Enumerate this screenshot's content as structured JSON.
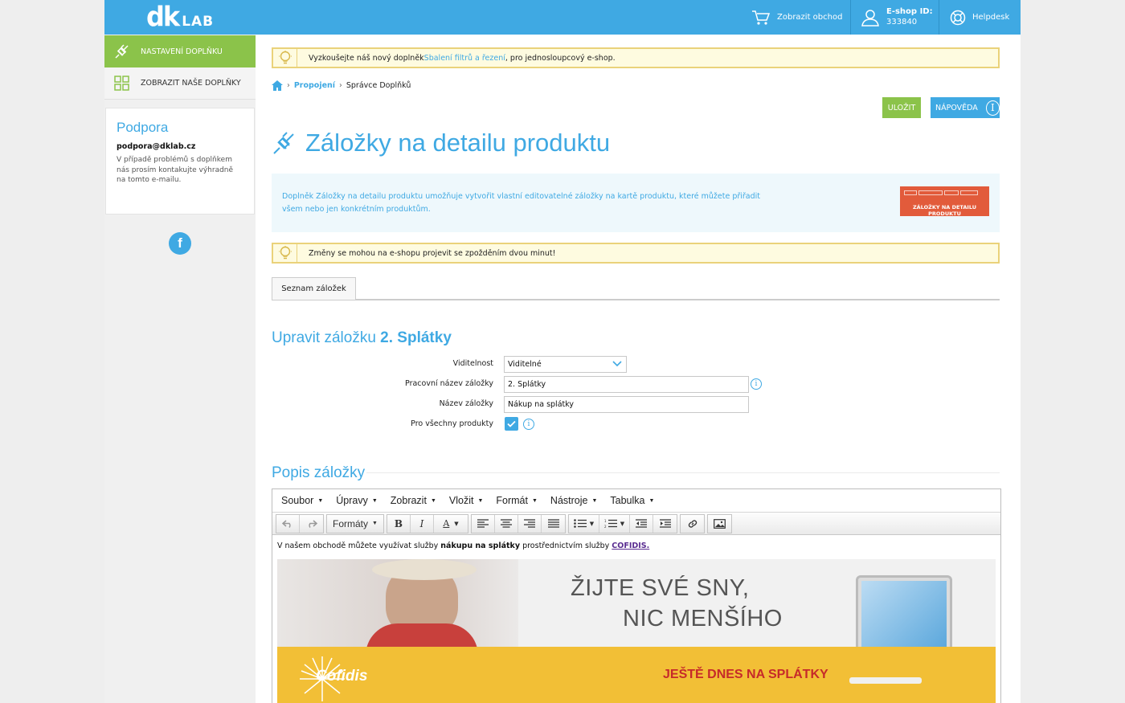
{
  "header": {
    "logo_dk": "dk",
    "logo_lab": "LAB",
    "shop_link": "Zobrazit obchod",
    "eshop_id_label": "E-shop ID:",
    "eshop_id_value": "333840",
    "helpdesk": "Helpdesk"
  },
  "sidebar": {
    "items": [
      {
        "label": "Nastavení doplňku",
        "icon": "plug-icon",
        "active": true
      },
      {
        "label": "Zobrazit naše doplňky",
        "icon": "grid-icon",
        "active": false
      }
    ],
    "support": {
      "title": "Podpora",
      "email": "podpora@dklab.cz",
      "text": "V případě problémů s doplňkem nás prosím kontakujte výhradně na tomto e-mailu."
    },
    "facebook": "f"
  },
  "notice_top": {
    "before": "Vyzkoušejte náš nový doplněk ",
    "link": "Sbalení filtrů a řezení",
    "after": ", pro jednosloupcový e-shop."
  },
  "breadcrumb": {
    "link": "Propojení",
    "current": "Správce Doplňků"
  },
  "buttons": {
    "save": "Uložit",
    "help": "Nápověda"
  },
  "page": {
    "title": "Záložky na detailu produktu"
  },
  "infobox": {
    "text": "Doplněk Záložky na detailu produktu umožňuje vytvořit vlastní editovatelné záložky na kartě produktu, které můžete přiřadit všem nebo jen konkrétním produktům.",
    "thumb_caption": "ZÁLOŽKY NA DETAILU PRODUKTU"
  },
  "notice_delay": "Změny se mohou na e-shopu projevit se zpožděním dvou minut!",
  "tabs": [
    "Seznam záložek"
  ],
  "edit_section": {
    "prefix": "Upravit záložku ",
    "name": "2. Splátky"
  },
  "form": {
    "visibility_label": "Viditelnost",
    "visibility_value": "Viditelné",
    "work_name_label": "Pracovní název záložky",
    "work_name_value": "2. Splátky",
    "tab_name_label": "Název záložky",
    "tab_name_value": "Nákup na splátky",
    "all_products_label": "Pro všechny produkty",
    "all_products_checked": true
  },
  "description": {
    "title": "Popis záložky",
    "menu": [
      "Soubor",
      "Úpravy",
      "Zobrazit",
      "Vložit",
      "Formát",
      "Nástroje",
      "Tabulka"
    ],
    "formats_label": "Formáty",
    "content_before": "V našem obchodě můžete využívat služby ",
    "content_bold": "nákupu na splátky",
    "content_middle": " prostřednictvím služby ",
    "content_link": "COFIDIS.",
    "banner_line1": "ŽIJTE SVÉ SNY,",
    "banner_line2": "NIC MENŠÍHO",
    "banner_brand": "Cofidis",
    "banner_cta": "JEŠTĚ DNES NA SPLÁTKY"
  },
  "colors": {
    "brand_blue": "#3fa9e3",
    "green": "#8bc34a",
    "notice_yellow": "#fefbe0",
    "banner_yellow": "#f2bf36"
  }
}
